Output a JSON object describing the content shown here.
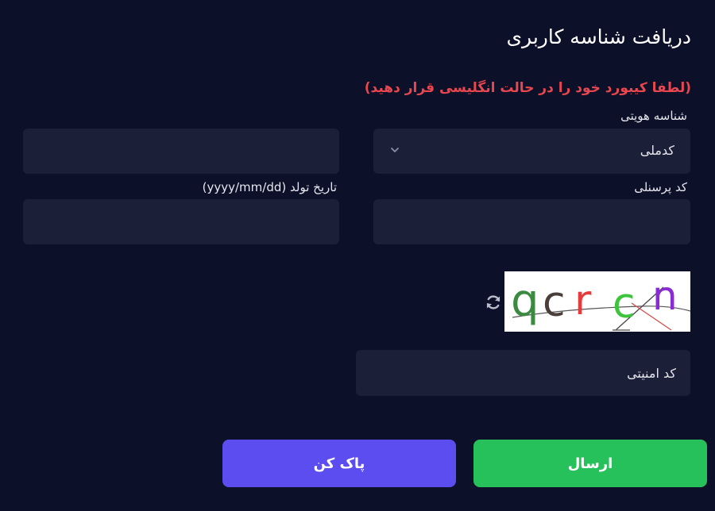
{
  "form": {
    "title": "دریافت شناسه کاربری",
    "notice": "(لطفا کیبورد خود را در حالت انگلیسی قرار دهید)",
    "id_type": {
      "label": "شناسه هویتی",
      "selected": "کدملی"
    },
    "id_value": {
      "value": ""
    },
    "personnel_code": {
      "label": "کد پرسنلی",
      "value": ""
    },
    "birth_date": {
      "label": "تاریخ تولد (yyyy/mm/dd)",
      "value": ""
    },
    "captcha": {
      "characters": [
        "q",
        "c",
        "r",
        "c",
        "n"
      ],
      "icon": "refresh-icon"
    },
    "security_code": {
      "placeholder": "کد امنیتی"
    },
    "buttons": {
      "submit": "ارسال",
      "clear": "پاک کن"
    }
  },
  "colors": {
    "background": "#0d1029",
    "field": "#1c1f38",
    "notice": "#e8474f",
    "submit": "#27c15b",
    "clear": "#5c4df0"
  }
}
